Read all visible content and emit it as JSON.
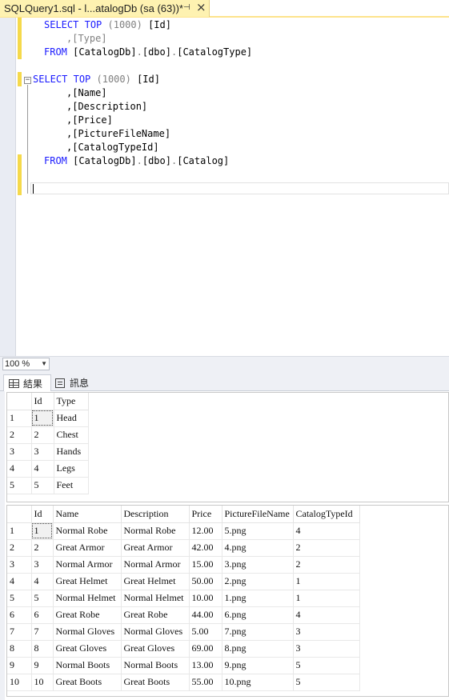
{
  "tab": {
    "title": "SQLQuery1.sql - l...atalogDb (sa (63))*",
    "pin_glyph": "⊣",
    "close_glyph": "×"
  },
  "editor": {
    "query1": {
      "line1": [
        "SELECT",
        " ",
        "TOP",
        " (1000) ",
        "[Id]"
      ],
      "line2": ",[Type]",
      "line3": [
        "FROM",
        " ",
        "[CatalogDb]",
        ".",
        "[dbo]",
        ".",
        "[CatalogType]"
      ]
    },
    "query2": {
      "line1": [
        "SELECT",
        " ",
        "TOP",
        " (1000) ",
        "[Id]"
      ],
      "cols": [
        ",[Name]",
        ",[Description]",
        ",[Price]",
        ",[PictureFileName]",
        ",[CatalogTypeId]"
      ],
      "from": [
        "FROM",
        " ",
        "[CatalogDb]",
        ".",
        "[dbo]",
        ".",
        "[Catalog]"
      ]
    },
    "fold_glyph": "−"
  },
  "zoom": {
    "value": "100 %"
  },
  "result_tabs": {
    "results": "結果",
    "messages": "訊息"
  },
  "grid1": {
    "headers": [
      "Id",
      "Type"
    ],
    "rows": [
      [
        "1",
        "1",
        "Head"
      ],
      [
        "2",
        "2",
        "Chest"
      ],
      [
        "3",
        "3",
        "Hands"
      ],
      [
        "4",
        "4",
        "Legs"
      ],
      [
        "5",
        "5",
        "Feet"
      ]
    ]
  },
  "grid2": {
    "headers": [
      "Id",
      "Name",
      "Description",
      "Price",
      "PictureFileName",
      "CatalogTypeId"
    ],
    "rows": [
      [
        "1",
        "1",
        "Normal Robe",
        "Normal Robe",
        "12.00",
        "5.png",
        "4"
      ],
      [
        "2",
        "2",
        "Great Armor",
        "Great Armor",
        "42.00",
        "4.png",
        "2"
      ],
      [
        "3",
        "3",
        "Normal Armor",
        "Normal Armor",
        "15.00",
        "3.png",
        "2"
      ],
      [
        "4",
        "4",
        "Great Helmet",
        "Great Helmet",
        "50.00",
        "2.png",
        "1"
      ],
      [
        "5",
        "5",
        "Normal Helmet",
        "Normal Helmet",
        "10.00",
        "1.png",
        "1"
      ],
      [
        "6",
        "6",
        "Great Robe",
        "Great Robe",
        "44.00",
        "6.png",
        "4"
      ],
      [
        "7",
        "7",
        "Normal Gloves",
        "Normal Gloves",
        "5.00",
        "7.png",
        "3"
      ],
      [
        "8",
        "8",
        "Great Gloves",
        "Great Gloves",
        "69.00",
        "8.png",
        "3"
      ],
      [
        "9",
        "9",
        "Normal Boots",
        "Normal Boots",
        "13.00",
        "9.png",
        "5"
      ],
      [
        "10",
        "10",
        "Great Boots",
        "Great Boots",
        "55.00",
        "10.png",
        "5"
      ]
    ]
  }
}
